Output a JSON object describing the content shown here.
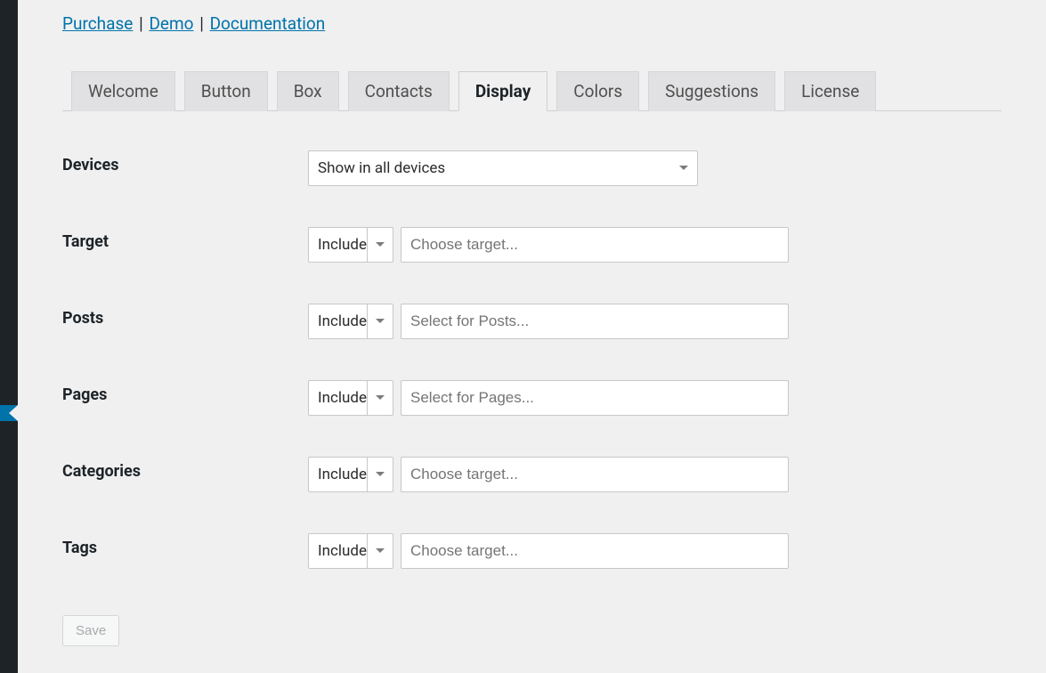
{
  "top_links": {
    "purchase": "Purchase",
    "demo": "Demo",
    "documentation": "Documentation",
    "sep": " | "
  },
  "tabs": [
    {
      "id": "welcome",
      "label": "Welcome",
      "active": false
    },
    {
      "id": "button",
      "label": "Button",
      "active": false
    },
    {
      "id": "box",
      "label": "Box",
      "active": false
    },
    {
      "id": "contacts",
      "label": "Contacts",
      "active": false
    },
    {
      "id": "display",
      "label": "Display",
      "active": true
    },
    {
      "id": "colors",
      "label": "Colors",
      "active": false
    },
    {
      "id": "suggestions",
      "label": "Suggestions",
      "active": false
    },
    {
      "id": "license",
      "label": "License",
      "active": false
    }
  ],
  "include_label": "Include",
  "rows": {
    "devices": {
      "label": "Devices",
      "value": "Show in all devices"
    },
    "target": {
      "label": "Target",
      "placeholder": "Choose target..."
    },
    "posts": {
      "label": "Posts",
      "placeholder": "Select for Posts..."
    },
    "pages": {
      "label": "Pages",
      "placeholder": "Select for Pages..."
    },
    "categories": {
      "label": "Categories",
      "placeholder": "Choose target..."
    },
    "tags": {
      "label": "Tags",
      "placeholder": "Choose target..."
    }
  },
  "save_label": "Save"
}
